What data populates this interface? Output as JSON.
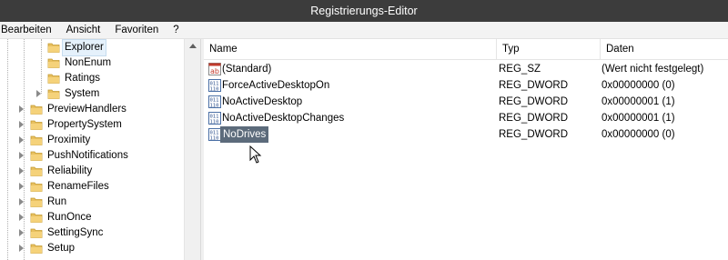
{
  "window": {
    "title": "Registrierungs-Editor"
  },
  "menu": [
    "Bearbeiten",
    "Ansicht",
    "Favoriten",
    "?"
  ],
  "tree": {
    "items": [
      {
        "label": "Explorer",
        "selected": true
      },
      {
        "label": "NonEnum",
        "selected": false
      },
      {
        "label": "Ratings",
        "selected": false
      },
      {
        "label": "System",
        "selected": false
      },
      {
        "label": "PreviewHandlers",
        "selected": false
      },
      {
        "label": "PropertySystem",
        "selected": false
      },
      {
        "label": "Proximity",
        "selected": false
      },
      {
        "label": "PushNotifications",
        "selected": false
      },
      {
        "label": "Reliability",
        "selected": false
      },
      {
        "label": "RenameFiles",
        "selected": false
      },
      {
        "label": "Run",
        "selected": false
      },
      {
        "label": "RunOnce",
        "selected": false
      },
      {
        "label": "SettingSync",
        "selected": false
      },
      {
        "label": "Setup",
        "selected": false
      }
    ]
  },
  "list": {
    "columns": {
      "name": "Name",
      "type": "Typ",
      "data": "Daten"
    },
    "rows": [
      {
        "name": "(Standard)",
        "type": "REG_SZ",
        "data": "(Wert nicht festgelegt)",
        "icon": "string-value-icon",
        "selected": false
      },
      {
        "name": "ForceActiveDesktopOn",
        "type": "REG_DWORD",
        "data": "0x00000000 (0)",
        "icon": "dword-value-icon",
        "selected": false
      },
      {
        "name": "NoActiveDesktop",
        "type": "REG_DWORD",
        "data": "0x00000001 (1)",
        "icon": "dword-value-icon",
        "selected": false
      },
      {
        "name": "NoActiveDesktopChanges",
        "type": "REG_DWORD",
        "data": "0x00000001 (1)",
        "icon": "dword-value-icon",
        "selected": false
      },
      {
        "name": "NoDrives",
        "type": "REG_DWORD",
        "data": "0x00000000 (0)",
        "icon": "dword-value-icon",
        "selected": true
      }
    ]
  },
  "colors": {
    "titlebar": "#3c3c3c",
    "selection": "#5c6b7b",
    "folder": "#e8c060"
  }
}
